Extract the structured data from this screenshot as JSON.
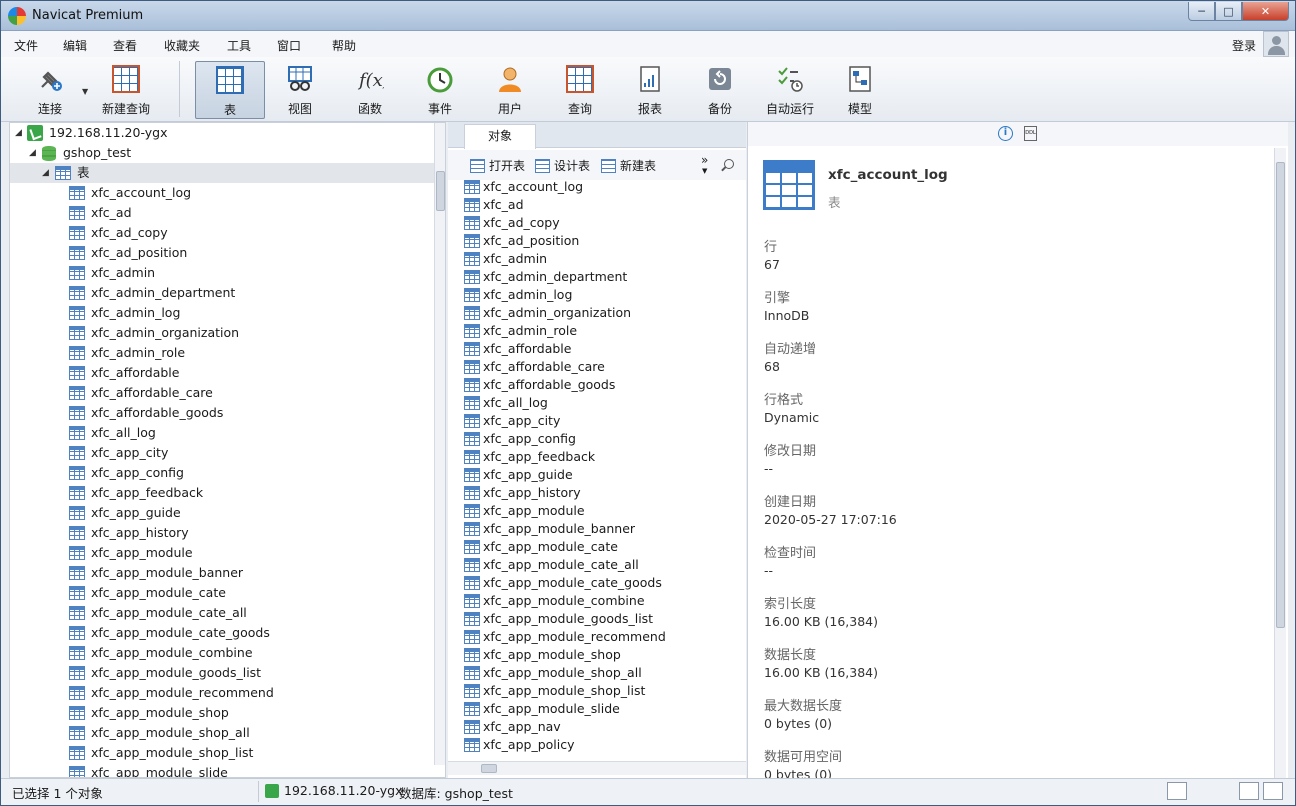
{
  "window": {
    "title": "Navicat Premium",
    "min": "─",
    "max": "□",
    "close": "✕"
  },
  "menu": {
    "items": [
      "文件",
      "编辑",
      "查看",
      "收藏夹",
      "工具",
      "窗口",
      "帮助"
    ],
    "login": "登录"
  },
  "toolbar": {
    "connect": "连接",
    "new_query": "新建查询",
    "buttons": [
      "表",
      "视图",
      "函数",
      "事件",
      "用户",
      "查询",
      "报表",
      "备份",
      "自动运行",
      "模型"
    ],
    "active": "表",
    "function_glyph": "f(x)"
  },
  "tree": {
    "connection": "192.168.11.20-ygx",
    "database": "gshop_test",
    "tables_node": "表",
    "tables": [
      "xfc_account_log",
      "xfc_ad",
      "xfc_ad_copy",
      "xfc_ad_position",
      "xfc_admin",
      "xfc_admin_department",
      "xfc_admin_log",
      "xfc_admin_organization",
      "xfc_admin_role",
      "xfc_affordable",
      "xfc_affordable_care",
      "xfc_affordable_goods",
      "xfc_all_log",
      "xfc_app_city",
      "xfc_app_config",
      "xfc_app_feedback",
      "xfc_app_guide",
      "xfc_app_history",
      "xfc_app_module",
      "xfc_app_module_banner",
      "xfc_app_module_cate",
      "xfc_app_module_cate_all",
      "xfc_app_module_cate_goods",
      "xfc_app_module_combine",
      "xfc_app_module_goods_list",
      "xfc_app_module_recommend",
      "xfc_app_module_shop",
      "xfc_app_module_shop_all",
      "xfc_app_module_shop_list",
      "xfc_app_module_slide"
    ]
  },
  "objects": {
    "tab": "对象",
    "open_table": "打开表",
    "design_table": "设计表",
    "new_table": "新建表",
    "more": "»",
    "list": [
      "xfc_account_log",
      "xfc_ad",
      "xfc_ad_copy",
      "xfc_ad_position",
      "xfc_admin",
      "xfc_admin_department",
      "xfc_admin_log",
      "xfc_admin_organization",
      "xfc_admin_role",
      "xfc_affordable",
      "xfc_affordable_care",
      "xfc_affordable_goods",
      "xfc_all_log",
      "xfc_app_city",
      "xfc_app_config",
      "xfc_app_feedback",
      "xfc_app_guide",
      "xfc_app_history",
      "xfc_app_module",
      "xfc_app_module_banner",
      "xfc_app_module_cate",
      "xfc_app_module_cate_all",
      "xfc_app_module_cate_goods",
      "xfc_app_module_combine",
      "xfc_app_module_goods_list",
      "xfc_app_module_recommend",
      "xfc_app_module_shop",
      "xfc_app_module_shop_all",
      "xfc_app_module_shop_list",
      "xfc_app_module_slide",
      "xfc_app_nav",
      "xfc_app_policy"
    ]
  },
  "info": {
    "info_glyph": "i",
    "ddl_glyph": "DDL",
    "name": "xfc_account_log",
    "type": "表",
    "props": [
      {
        "label": "行",
        "value": "67"
      },
      {
        "label": "引擎",
        "value": "InnoDB"
      },
      {
        "label": "自动递增",
        "value": "68"
      },
      {
        "label": "行格式",
        "value": "Dynamic"
      },
      {
        "label": "修改日期",
        "value": "--"
      },
      {
        "label": "创建日期",
        "value": "2020-05-27 17:07:16"
      },
      {
        "label": "检查时间",
        "value": "--"
      },
      {
        "label": "索引长度",
        "value": "16.00 KB (16,384)"
      },
      {
        "label": "数据长度",
        "value": "16.00 KB (16,384)"
      },
      {
        "label": "最大数据长度",
        "value": "0 bytes (0)"
      },
      {
        "label": "数据可用空间",
        "value": "0 bytes (0)"
      }
    ]
  },
  "status": {
    "selected": "已选择 1 个对象",
    "connection": "192.168.11.20-ygx",
    "database": "数据库: gshop_test"
  },
  "colors": {
    "accent": "#2e6db4",
    "green": "#3aa64a"
  }
}
